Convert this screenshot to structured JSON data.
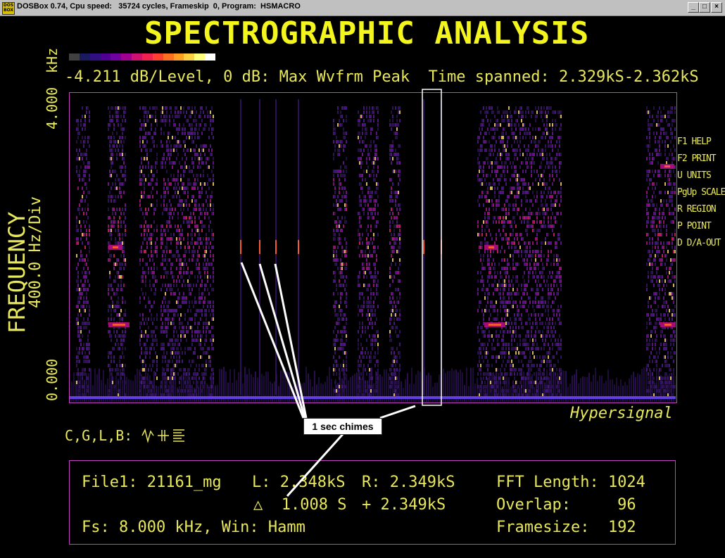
{
  "window": {
    "title": "DOSBox 0.74, Cpu speed:   35724 cycles, Frameskip  0, Program:  HSMACRO",
    "icon_text": "DOS BOX",
    "minimize_label": "_",
    "maximize_label": "□",
    "close_label": "×"
  },
  "app": {
    "title": "SPECTROGRAPHIC ANALYSIS",
    "info_line": "-4.211 dB/Level, 0 dB: Max Wvfrm Peak  Time spanned: 2.329kS-2.362kS",
    "palette_colors": [
      "#404040",
      "#1a1a60",
      "#301080",
      "#500090",
      "#7000a0",
      "#a00090",
      "#d01070",
      "#f02050",
      "#ff4030",
      "#ff7020",
      "#ffa020",
      "#ffd040",
      "#ffff80",
      "#ffffff"
    ]
  },
  "axis": {
    "frequency_label": "FREQUENCY",
    "unit_label": "400.0 Hz/Div",
    "tick_top": "4.000",
    "tick_bottom": "0.000",
    "unit_top": "kHz"
  },
  "function_keys": [
    "F1 HELP",
    "F2 PRINT",
    "U UNITS",
    "PgUp SCALE",
    "R REGION",
    "P POINT",
    "D D/A-OUT"
  ],
  "brand": "Hypersignal",
  "cursor_modes": "C,G,L,B:",
  "annotation": "1 sec chimes",
  "info": {
    "file": "File1: 21161_mg",
    "left": "L: 2.348kS",
    "right": "R: 2.349kS",
    "fft": "FFT Length: 1024",
    "delta": "△  1.008 S",
    "plus": "+ 2.349kS",
    "overlap": "Overlap:     96",
    "fs": "Fs: 8.000 kHz, Win: Hamm",
    "framesize": "Framesize:  192"
  },
  "colors": {
    "title_yellow": "#f5f51e",
    "text_yellow": "#e8e85a",
    "frame_magenta": "#c040c0"
  }
}
